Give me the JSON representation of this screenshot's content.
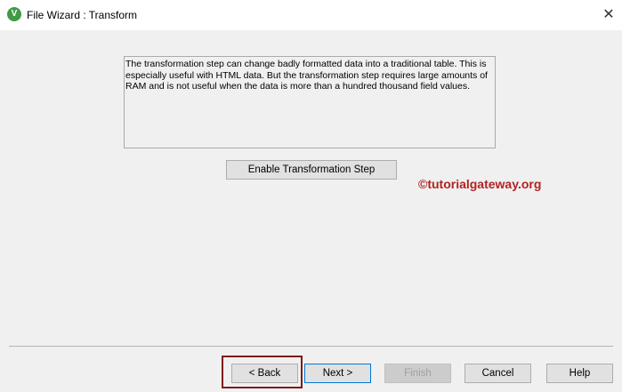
{
  "window": {
    "title": "File Wizard : Transform",
    "app_icon": "qlik-v-icon",
    "close_glyph": "✕"
  },
  "description": "The transformation step can change badly formatted data into a traditional table. This is especially useful with HTML data. But the transformation step requires large amounts of RAM and is not useful when the data is more than a hundred thousand field values.",
  "enable_button_label": "Enable Transformation Step",
  "watermark": "©tutorialgateway.org",
  "footer": {
    "back_label": "< Back",
    "next_label": "Next >",
    "finish_label": "Finish",
    "cancel_label": "Cancel",
    "help_label": "Help"
  },
  "colors": {
    "watermark": "#b22222",
    "highlight_box": "#7f1b1b",
    "app_icon": "#3f9b45"
  }
}
